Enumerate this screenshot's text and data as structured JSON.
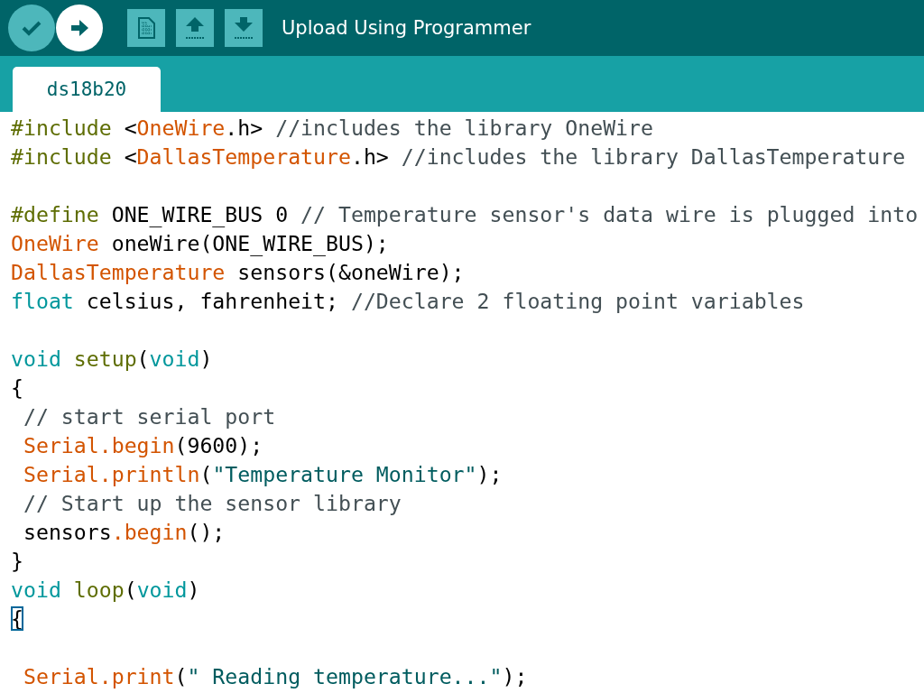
{
  "toolbar": {
    "buttons": [
      {
        "kind": "circle",
        "selected": false
      },
      {
        "kind": "circle",
        "selected": true
      },
      {
        "kind": "square",
        "selected": false
      },
      {
        "kind": "square",
        "selected": false
      },
      {
        "kind": "square",
        "selected": false
      }
    ],
    "status": "Upload Using Programmer"
  },
  "tabs": [
    {
      "label": "ds18b20",
      "selected": true
    }
  ],
  "editor": {
    "lines": [
      {
        "kind": "code",
        "tokens": [
          {
            "kind": "directive",
            "text": "#include"
          },
          {
            "kind": "plain",
            "text": " <"
          },
          {
            "kind": "type",
            "text": "OneWire"
          },
          {
            "kind": "plain",
            "text": ".h> "
          },
          {
            "kind": "comment",
            "text": "//includes the library OneWire"
          }
        ]
      },
      {
        "kind": "code",
        "tokens": [
          {
            "kind": "directive",
            "text": "#include"
          },
          {
            "kind": "plain",
            "text": " <"
          },
          {
            "kind": "type",
            "text": "DallasTemperature"
          },
          {
            "kind": "plain",
            "text": ".h> "
          },
          {
            "kind": "comment",
            "text": "//includes the library DallasTemperature"
          }
        ]
      },
      {
        "kind": "blank"
      },
      {
        "kind": "code",
        "tokens": [
          {
            "kind": "directive",
            "text": "#define"
          },
          {
            "kind": "plain",
            "text": " ONE_WIRE_BUS 0 "
          },
          {
            "kind": "comment",
            "text": "// Temperature sensor's data wire is plugged into"
          }
        ]
      },
      {
        "kind": "code",
        "tokens": [
          {
            "kind": "type",
            "text": "OneWire"
          },
          {
            "kind": "plain",
            "text": " oneWire(ONE_WIRE_BUS);"
          }
        ]
      },
      {
        "kind": "code",
        "tokens": [
          {
            "kind": "type",
            "text": "DallasTemperature"
          },
          {
            "kind": "plain",
            "text": " sensors(&oneWire);"
          }
        ]
      },
      {
        "kind": "code",
        "tokens": [
          {
            "kind": "keyword",
            "text": "float"
          },
          {
            "kind": "plain",
            "text": " celsius, fahrenheit; "
          },
          {
            "kind": "comment",
            "text": "//Declare 2 floating point variables"
          }
        ]
      },
      {
        "kind": "blank"
      },
      {
        "kind": "code",
        "tokens": [
          {
            "kind": "keyword",
            "text": "void"
          },
          {
            "kind": "directive",
            "text": " setup"
          },
          {
            "kind": "plain",
            "text": "("
          },
          {
            "kind": "keyword",
            "text": "void"
          },
          {
            "kind": "plain",
            "text": ")"
          }
        ]
      },
      {
        "kind": "code",
        "tokens": [
          {
            "kind": "plain",
            "text": "{"
          }
        ]
      },
      {
        "kind": "code",
        "tokens": [
          {
            "kind": "comment",
            "text": " // start serial port"
          }
        ]
      },
      {
        "kind": "code",
        "tokens": [
          {
            "kind": "type",
            "text": " Serial.begin"
          },
          {
            "kind": "plain",
            "text": "(9600);"
          }
        ]
      },
      {
        "kind": "code",
        "tokens": [
          {
            "kind": "type",
            "text": " Serial.println"
          },
          {
            "kind": "plain",
            "text": "("
          },
          {
            "kind": "string",
            "text": "\"Temperature Monitor\""
          },
          {
            "kind": "plain",
            "text": ");"
          }
        ]
      },
      {
        "kind": "code",
        "tokens": [
          {
            "kind": "comment",
            "text": " // Start up the sensor library"
          }
        ]
      },
      {
        "kind": "code",
        "tokens": [
          {
            "kind": "plain",
            "text": " sensors"
          },
          {
            "kind": "type",
            "text": ".begin"
          },
          {
            "kind": "plain",
            "text": "();"
          }
        ]
      },
      {
        "kind": "code",
        "tokens": [
          {
            "kind": "plain",
            "text": "}"
          }
        ]
      },
      {
        "kind": "code",
        "tokens": [
          {
            "kind": "keyword",
            "text": "void"
          },
          {
            "kind": "directive",
            "text": " loop"
          },
          {
            "kind": "plain",
            "text": "("
          },
          {
            "kind": "keyword",
            "text": "void"
          },
          {
            "kind": "plain",
            "text": ")"
          }
        ]
      },
      {
        "kind": "code",
        "tokens": [
          {
            "kind": "bracket-match",
            "text": "{"
          }
        ]
      },
      {
        "kind": "blank"
      },
      {
        "kind": "code",
        "tokens": [
          {
            "kind": "type",
            "text": " Serial.print"
          },
          {
            "kind": "plain",
            "text": "("
          },
          {
            "kind": "string",
            "text": "\" Reading temperature...\""
          },
          {
            "kind": "plain",
            "text": ");"
          }
        ]
      }
    ]
  }
}
